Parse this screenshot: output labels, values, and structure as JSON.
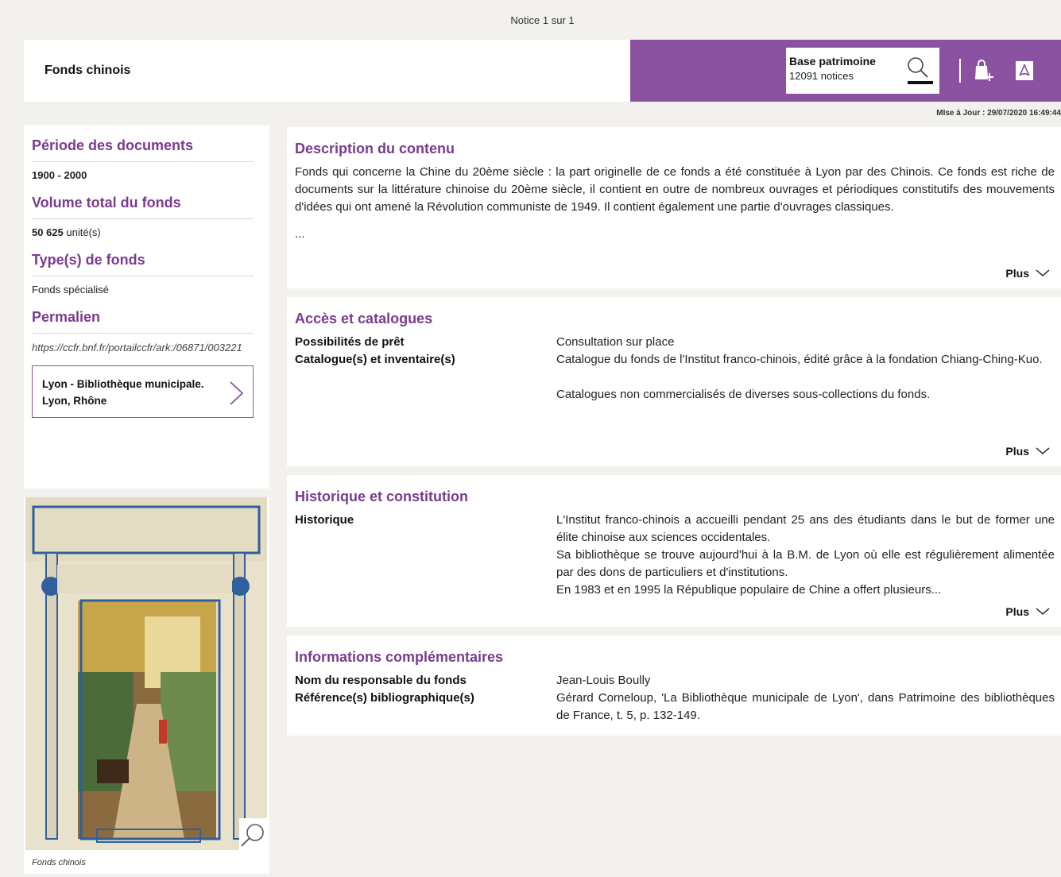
{
  "header": {
    "notice_count": "Notice 1 sur 1",
    "fonds_title": "Fonds chinois",
    "base_title": "Base patrimoine",
    "base_count": "12091 notices",
    "update": "MIse à Jour : 29/07/2020 16:49:44",
    "accent_color": "#8b52a1",
    "icons": [
      "search-icon",
      "add-to-basket-icon",
      "pdf-icon"
    ]
  },
  "sidebar": {
    "periode_title": "Période des documents",
    "periode_value": "1900 - 2000",
    "volume_title": "Volume total du fonds",
    "volume_number": "50 625",
    "volume_unit": " unité(s)",
    "type_title": "Type(s) de fonds",
    "type_value": "Fonds spécialisé",
    "permalien_title": "Permalien",
    "permalien_value": "https://ccfr.bnf.fr/portailccfr/ark:/06871/003221",
    "library_line1": "Lyon - Bibliothèque municipale.",
    "library_line2": "Lyon, Rhône",
    "image_caption": "Fonds chinois"
  },
  "sections": {
    "description": {
      "title": "Description du contenu",
      "text": "Fonds qui concerne la Chine du 20ème siècle : la part originelle de ce fonds a été constituée à Lyon par des Chinois. Ce fonds est riche de documents sur la littérature chinoise du 20ème siècle, il contient en outre de nombreux ouvrages et périodiques constitutifs des mouvements d'idées qui ont amené la Révolution communiste de 1949. Il contient également une partie d'ouvrages classiques.",
      "ellipsis": "...",
      "more": "Plus"
    },
    "acces": {
      "title": "Accès et catalogues",
      "pret_label": "Possibilités de prêt",
      "pret_value": "Consultation sur place",
      "catalogue_label": "Catalogue(s) et inventaire(s)",
      "catalogue_value1": "Catalogue du fonds de l'Institut franco-chinois, édité grâce à la fondation Chiang-Ching-Kuo.",
      "catalogue_value2": "Catalogues non commercialisés de diverses sous-collections du fonds.",
      "more": "Plus"
    },
    "historique": {
      "title": "Historique et constitution",
      "label": "Historique",
      "line1": "L'Institut franco-chinois a accueilli pendant 25 ans des étudiants dans le but de former une élite chinoise aux sciences occidentales.",
      "line2": "Sa bibliothèque se trouve aujourd'hui à la B.M. de Lyon où elle est régulièrement alimentée par des dons de particuliers et d'institutions.",
      "line3": "En 1983 et en 1995 la République populaire de Chine a offert plusieurs...",
      "more": "Plus"
    },
    "infos": {
      "title": "Informations complémentaires",
      "resp_label": "Nom du responsable du fonds",
      "resp_value": "Jean-Louis Boully",
      "ref_label": "Référence(s) bibliographique(s)",
      "ref_value": "Gérard Corneloup, 'La Bibliothèque municipale de Lyon', dans Patrimoine des bibliothèques de France, t. 5, p. 132-149."
    }
  }
}
